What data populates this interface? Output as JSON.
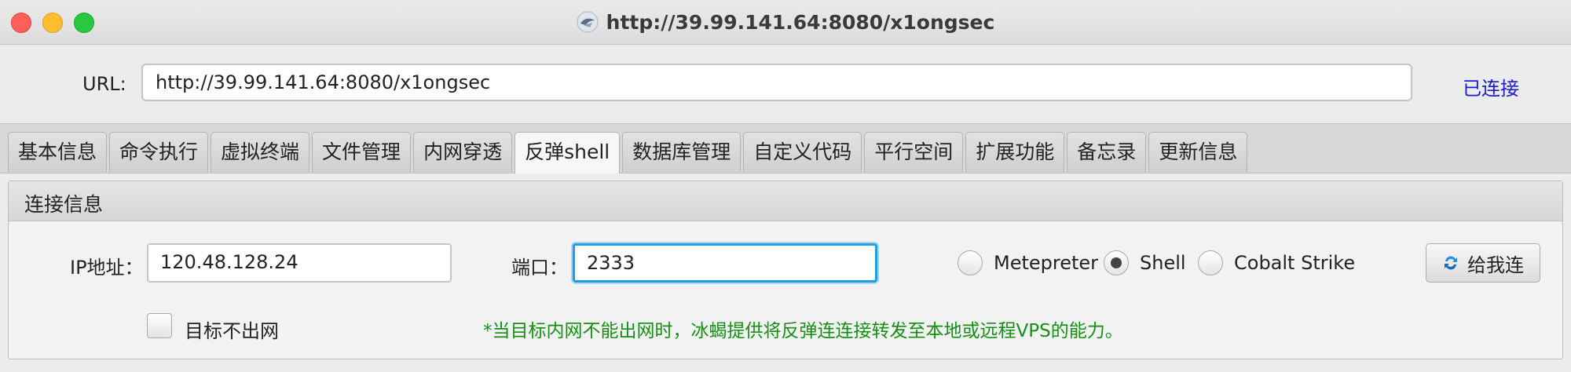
{
  "window": {
    "title": "http://39.99.141.64:8080/x1ongsec",
    "app_icon": "behinder-logo-icon"
  },
  "url_bar": {
    "label": "URL:",
    "value": "http://39.99.141.64:8080/x1ongsec",
    "status": "已连接",
    "status_color": "#1a1ad0"
  },
  "tabs": [
    {
      "label": "基本信息"
    },
    {
      "label": "命令执行"
    },
    {
      "label": "虚拟终端"
    },
    {
      "label": "文件管理"
    },
    {
      "label": "内网穿透"
    },
    {
      "label": "反弹shell",
      "active": true
    },
    {
      "label": "数据库管理"
    },
    {
      "label": "自定义代码"
    },
    {
      "label": "平行空间"
    },
    {
      "label": "扩展功能"
    },
    {
      "label": "备忘录"
    },
    {
      "label": "更新信息"
    }
  ],
  "panel": {
    "title": "连接信息",
    "ip_label": "IP地址：",
    "ip_value": "120.48.128.24",
    "port_label": "端口：",
    "port_value": "2333",
    "radio_options": [
      {
        "label": "Metepreter",
        "checked": false
      },
      {
        "label": "Shell",
        "checked": true
      },
      {
        "label": "Cobalt Strike",
        "checked": false
      }
    ],
    "connect_button": "给我连",
    "connect_icon": "refresh-sync-icon",
    "no_outbound_label": "目标不出网",
    "no_outbound_checked": false,
    "hint": "*当目标内网不能出网时，冰蝎提供将反弹连连接转发至本地或远程VPS的能力。",
    "hint_color": "#168f16"
  }
}
